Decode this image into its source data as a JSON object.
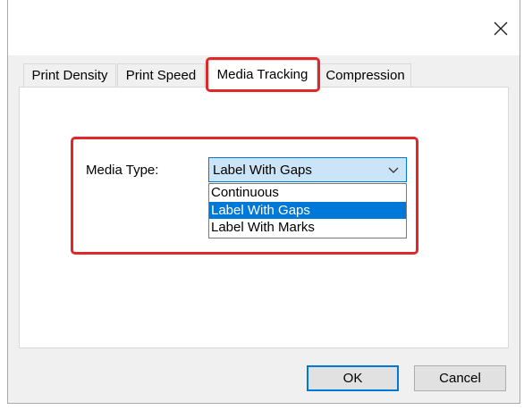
{
  "dialog": {
    "close_glyph": "✕"
  },
  "tabs": [
    {
      "label": "Print Density"
    },
    {
      "label": "Print Speed"
    },
    {
      "label": "Media Tracking"
    },
    {
      "label": "Compression"
    }
  ],
  "media_type": {
    "label": "Media Type:",
    "selected_value": "Label With Gaps",
    "options": [
      "Continuous",
      "Label With Gaps",
      "Label With Marks"
    ]
  },
  "buttons": {
    "ok_label": "OK",
    "cancel_label": "Cancel"
  },
  "colors": {
    "highlight": "#e0282b",
    "accent": "#0078d7",
    "selected_text": "#ffffff"
  },
  "icons": {
    "close": "close-icon",
    "dropdown": "chevron-down-icon"
  }
}
